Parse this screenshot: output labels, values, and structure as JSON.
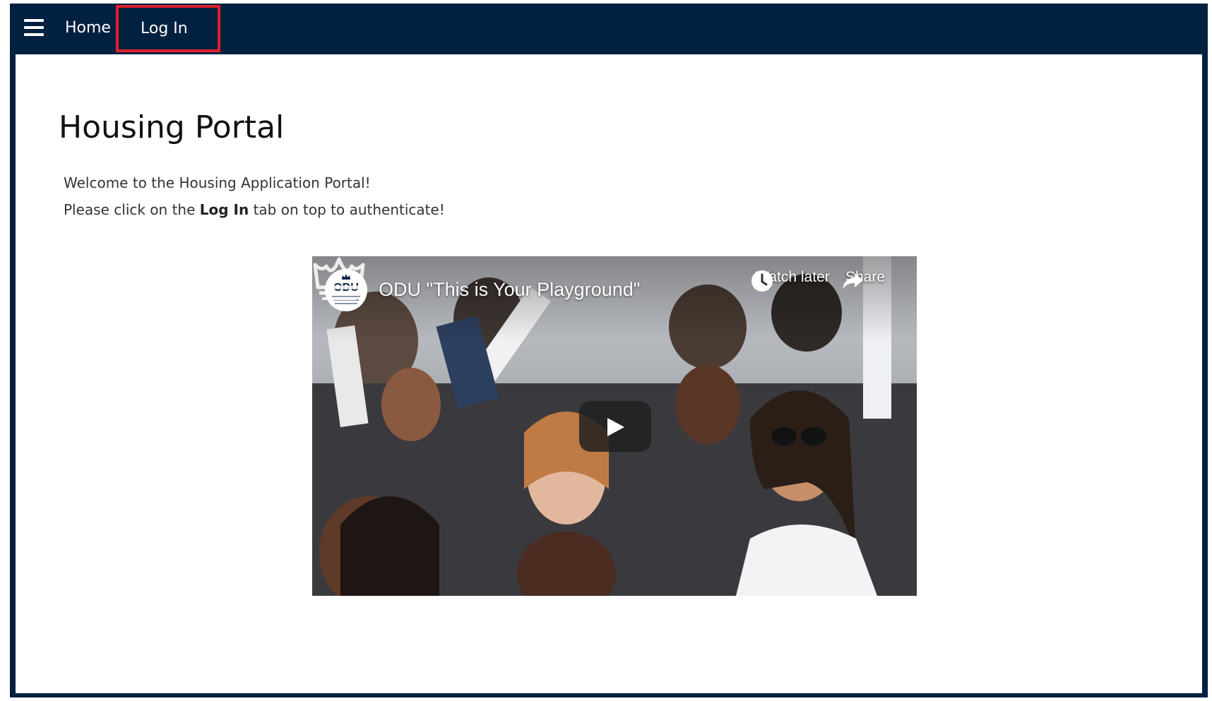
{
  "nav": {
    "menu_icon": "hamburger-menu-icon",
    "home_label": "Home",
    "login_label": "Log In",
    "bar_color": "#02203f",
    "highlight_color": "#e0202e"
  },
  "page": {
    "title": "Housing Portal",
    "welcome_line": "Welcome to the Housing Application Portal!",
    "instruction_prefix": "Please click on the ",
    "instruction_bold": "Log In",
    "instruction_suffix": " tab on top to authenticate!"
  },
  "video": {
    "channel_logo_text": "ODU",
    "title": "ODU \"This is Your Playground\"",
    "watch_later_label": "Watch later",
    "share_label": "Share",
    "play_icon": "play-icon",
    "watch_later_icon": "clock-icon",
    "share_icon": "share-arrow-icon",
    "watermark_icon": "crown-icon"
  }
}
